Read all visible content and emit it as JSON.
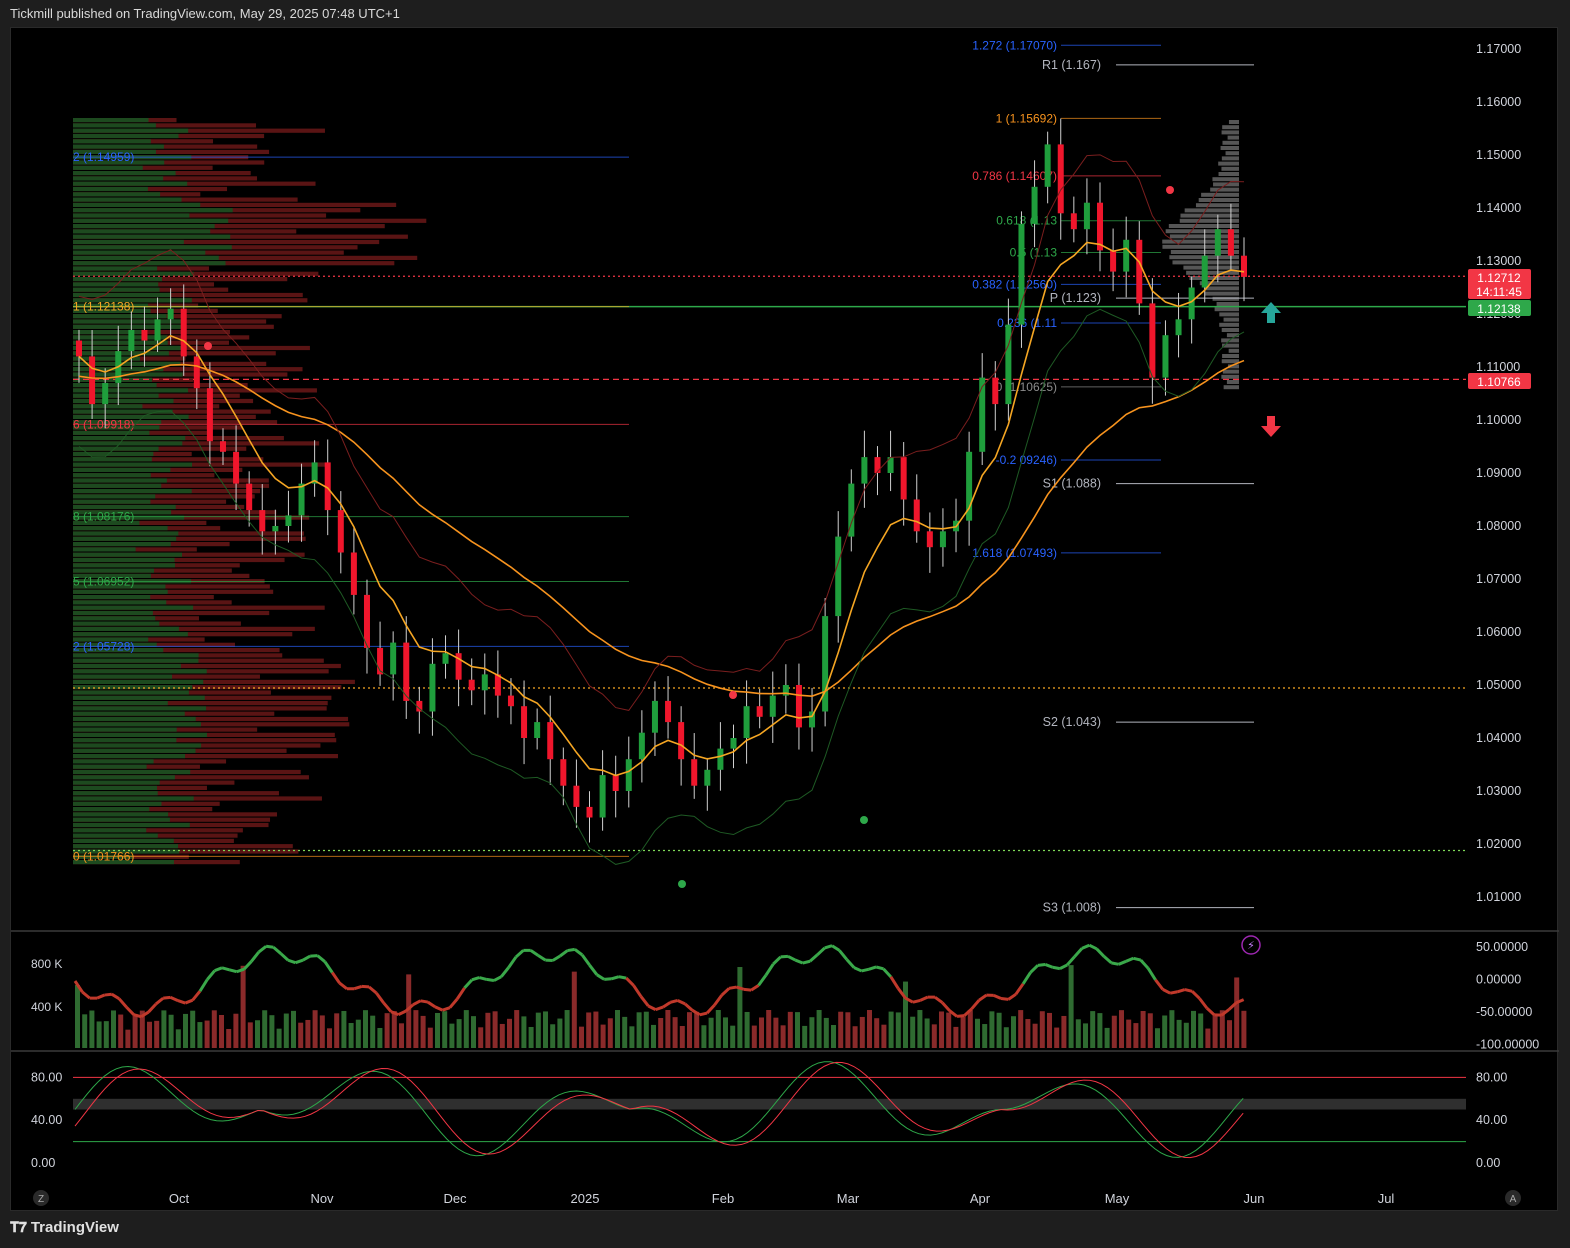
{
  "header": {
    "title": "Tickmill published on TradingView.com, May 29, 2025 07:48 UTC+1"
  },
  "footer": {
    "brand": "TradingView",
    "logo_icon": "tradingview-logo-icon"
  },
  "colors": {
    "up": "#1f9e3c",
    "down": "#f0162c",
    "ema_fast": "#f5a623",
    "ema_slow": "#f7931e",
    "price_label": "#f23645",
    "support_label": "#2ea84a",
    "fib_blue": "#2962ff"
  },
  "chart_data": [
    {
      "type": "candlestick",
      "symbol_scale": "price",
      "ylim": [
        1.0,
        1.175
      ],
      "y_ticks": [
        "1.17000",
        "1.16000",
        "1.15000",
        "1.14000",
        "1.13000",
        "1.12000",
        "1.11000",
        "1.10000",
        "1.09000",
        "1.08000",
        "1.07000",
        "1.06000",
        "1.05000",
        "1.04000",
        "1.03000",
        "1.02000",
        "1.01000"
      ],
      "x_ticks": [
        "Oct",
        "Nov",
        "Dec",
        "2025",
        "Feb",
        "Mar",
        "Apr",
        "May",
        "Jun",
        "Jul"
      ],
      "price_labels": [
        {
          "text": "1.12712",
          "color": "#f23645"
        },
        {
          "text": "14:11:45",
          "color": "#f23645"
        },
        {
          "text": "1.12138",
          "color": "#2ea84a"
        },
        {
          "text": "1.10766",
          "color": "#f23645"
        }
      ],
      "fib_left": [
        {
          "label": "2 (1.14959)",
          "price": 1.14959,
          "color": "#2962ff"
        },
        {
          "label": "1 (1.12138)",
          "price": 1.12138,
          "color": "#f5a623"
        },
        {
          "label": "6 (1.09918)",
          "price": 1.09918,
          "color": "#f23645"
        },
        {
          "label": "8 (1.08176)",
          "price": 1.08176,
          "color": "#2ea84a"
        },
        {
          "label": "5 (1.06952)",
          "price": 1.06952,
          "color": "#2ea84a"
        },
        {
          "label": "2 (1.05728)",
          "price": 1.05728,
          "color": "#2962ff"
        },
        {
          "label": "0 (1.01766)",
          "price": 1.01766,
          "color": "#f7931e"
        }
      ],
      "fib_right": [
        {
          "label": "1.272 (1.17070)",
          "price": 1.1707,
          "color": "#2962ff"
        },
        {
          "label": "1 (1.15692)",
          "price": 1.15692,
          "color": "#f7931e"
        },
        {
          "label": "0.786 (1.14607)",
          "price": 1.14607,
          "color": "#f23645"
        },
        {
          "label": "0.618 (1.13",
          "price": 1.1376,
          "color": "#2ea84a"
        },
        {
          "label": "0.5 (1.13",
          "price": 1.1316,
          "color": "#2ea84a"
        },
        {
          "label": "0.382 (1.12560)",
          "price": 1.1256,
          "color": "#2962ff"
        },
        {
          "label": "0.236 (1.11",
          "price": 1.1183,
          "color": "#2962ff"
        },
        {
          "label": "0 (1.10625)",
          "price": 1.10625,
          "color": "#8c8c8c"
        },
        {
          "label": "-0.2   09246)",
          "price": 1.09246,
          "color": "#2962ff"
        },
        {
          "label": "1.618 (1.07493)",
          "price": 1.07493,
          "color": "#2962ff"
        }
      ],
      "pivots": [
        {
          "label": "R1 (1.167)",
          "price": 1.167
        },
        {
          "label": "P (1.123)",
          "price": 1.123
        },
        {
          "label": "S1 (1.088)",
          "price": 1.088
        },
        {
          "label": "S2 (1.043)",
          "price": 1.043
        },
        {
          "label": "S3 (1.008)",
          "price": 1.008
        }
      ],
      "horizontal_lines": [
        {
          "price": 1.12712,
          "style": "dotted",
          "color": "#f23645"
        },
        {
          "price": 1.12138,
          "style": "solid",
          "color": "#2ea84a"
        },
        {
          "price": 1.10766,
          "style": "dashed",
          "color": "#f23645"
        },
        {
          "price": 1.04943,
          "style": "dotted",
          "color": "#f5a623"
        },
        {
          "price": 1.01878,
          "style": "dotted",
          "color": "#7ed957"
        }
      ],
      "close_series": [
        1.112,
        1.103,
        1.107,
        1.113,
        1.117,
        1.115,
        1.119,
        1.121,
        1.112,
        1.106,
        1.096,
        1.094,
        1.088,
        1.083,
        1.079,
        1.08,
        1.082,
        1.088,
        1.092,
        1.083,
        1.075,
        1.067,
        1.057,
        1.052,
        1.058,
        1.047,
        1.045,
        1.054,
        1.056,
        1.051,
        1.049,
        1.052,
        1.048,
        1.046,
        1.04,
        1.043,
        1.036,
        1.031,
        1.027,
        1.025,
        1.033,
        1.03,
        1.036,
        1.041,
        1.047,
        1.043,
        1.036,
        1.031,
        1.034,
        1.038,
        1.04,
        1.046,
        1.044,
        1.048,
        1.05,
        1.042,
        1.045,
        1.063,
        1.078,
        1.088,
        1.093,
        1.09,
        1.093,
        1.085,
        1.079,
        1.076,
        1.079,
        1.081,
        1.094,
        1.108,
        1.103,
        1.118,
        1.137,
        1.144,
        1.152,
        1.139,
        1.136,
        1.141,
        1.132,
        1.128,
        1.134,
        1.122,
        1.108,
        1.116,
        1.119,
        1.125,
        1.131,
        1.136,
        1.131,
        1.127
      ],
      "markers": [
        "up-arrow",
        "down-arrow",
        "lightning-icon"
      ]
    },
    {
      "type": "histogram_line",
      "title": "volume",
      "y_ticks_left": [
        "800 K",
        "400 K"
      ],
      "y_ticks_right": [
        "50.00000",
        "0.00000",
        "-50.00000",
        "-100.00000"
      ]
    },
    {
      "type": "line",
      "title": "stochastic",
      "y_ticks": [
        "80.00",
        "40.00",
        "0.00"
      ],
      "band": [
        50,
        60
      ],
      "levels": [
        80,
        20
      ]
    }
  ],
  "time_axis": {
    "left_button": "Z",
    "right_button": "A"
  }
}
